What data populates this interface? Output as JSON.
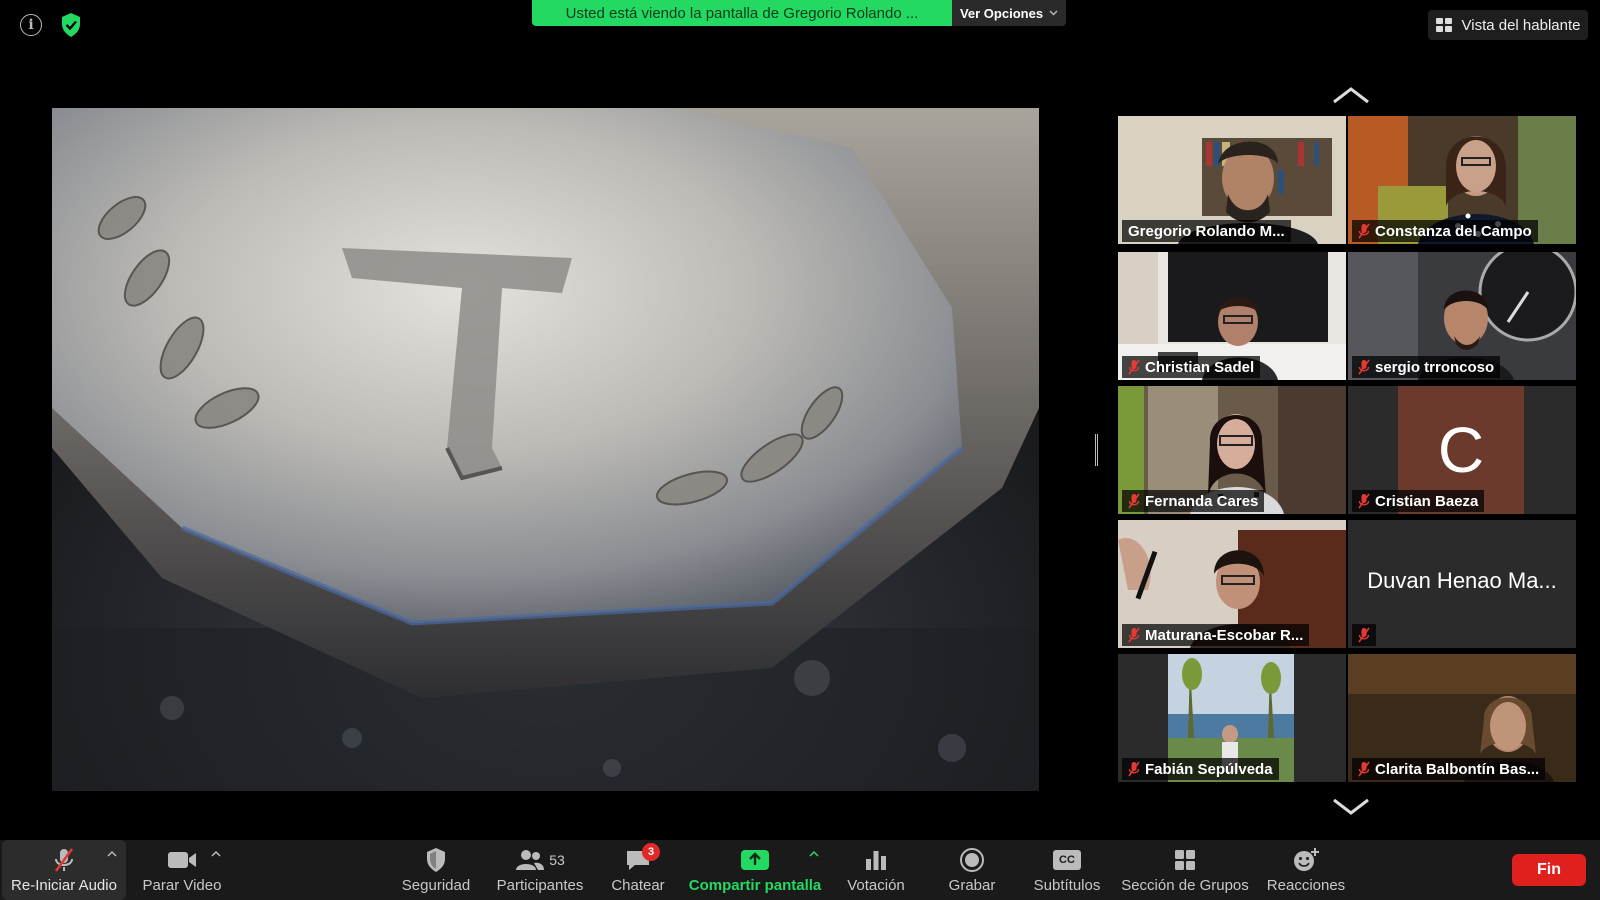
{
  "top": {
    "sharing_banner": "Usted está viendo la pantalla de Gregorio Rolando ...",
    "view_options": "Ver Opciones",
    "speaker_view": "Vista del hablante"
  },
  "participants": [
    {
      "name": "Gregorio Rolando M...",
      "active": true
    },
    {
      "name": "Constanza del Campo"
    },
    {
      "name": "Christian Sadel"
    },
    {
      "name": "sergio trroncoso"
    },
    {
      "name": "Fernanda Cares"
    },
    {
      "name": "Cristian Baeza",
      "avatar_letter": "C"
    },
    {
      "name": "Maturana-Escobar R..."
    },
    {
      "name": "Duvan Henao Ma..."
    },
    {
      "name": "Fabián Sepúlveda"
    },
    {
      "name": "Clarita Balbontín Bas..."
    }
  ],
  "toolbar": {
    "audio": "Re-Iniciar Audio",
    "video": "Parar Video",
    "security": "Seguridad",
    "participants": "Participantes",
    "participants_count": "53",
    "chat": "Chatear",
    "chat_badge": "3",
    "share": "Compartir pantalla",
    "poll": "Votación",
    "record": "Grabar",
    "subtitles": "Subtítulos",
    "subtitles_icon_text": "CC",
    "breakout": "Sección de Grupos",
    "reactions": "Reacciones",
    "end": "Fin"
  },
  "colors": {
    "share_green": "#23d962",
    "active_speaker": "#c6f227",
    "end_red": "#e0201c",
    "muted_red": "#e53935"
  }
}
